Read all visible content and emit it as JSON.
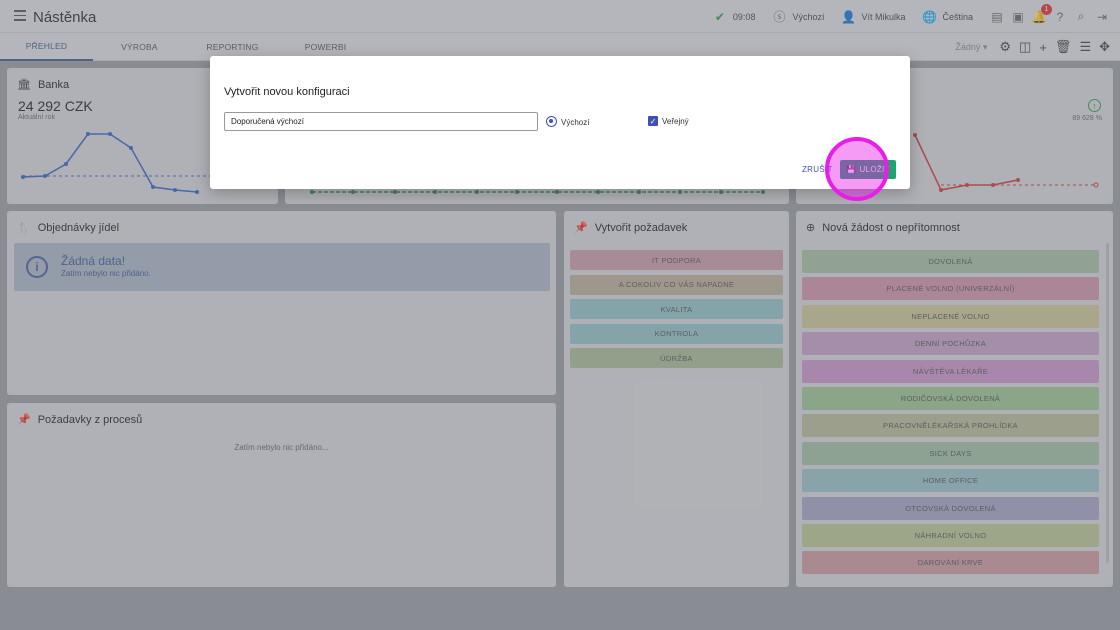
{
  "header": {
    "title": "Nástěnka",
    "time": "09:08",
    "profile": "Výchozí",
    "user": "Vít Mikulka",
    "language": "Čeština",
    "notif_count": "1"
  },
  "tabs": [
    "PŘEHLED",
    "VÝROBA",
    "REPORTING",
    "POWERBI"
  ],
  "toolbar": {
    "select_value": "Žádný"
  },
  "bank": {
    "title": "Banka",
    "amount": "24 292 CZK",
    "subtitle": "Aktuální rok",
    "right_value": "89 628 %"
  },
  "orders": {
    "title": "Objednávky jídel",
    "empty_title": "Žádná data!",
    "empty_text": "Zatím nebylo nic přidáno."
  },
  "requests": {
    "title": "Požadavky z procesů",
    "empty_text": "Zatím nebylo nic přidáno..."
  },
  "create_request": {
    "title": "Vytvořit požadavek",
    "items": [
      {
        "label": "IT PODPORA",
        "color": "#c79aa6"
      },
      {
        "label": "A COKOLIV CO VÁS NAPADNE",
        "color": "#b9ad95"
      },
      {
        "label": "KVALITA",
        "color": "#92c0c4"
      },
      {
        "label": "KONTROLA",
        "color": "#92c0c4"
      },
      {
        "label": "ÚDRŽBA",
        "color": "#a6bb96"
      }
    ]
  },
  "absence": {
    "title": "Nová žádost o nepřítomnost",
    "items": [
      {
        "label": "DOVOLENÁ",
        "color": "#a6bea0"
      },
      {
        "label": "PLACENÉ VOLNO (UNIVERZÁLNÍ)",
        "color": "#cc93a8"
      },
      {
        "label": "NEPLACENÉ VOLNO",
        "color": "#c9c495"
      },
      {
        "label": "DENNÍ POCHŮZKA",
        "color": "#c29ec5"
      },
      {
        "label": "NÁVŠTĚVA LÉKAŘE",
        "color": "#c696c8"
      },
      {
        "label": "RODIČOVSKÁ DOVOLENÁ",
        "color": "#9cc292"
      },
      {
        "label": "PRACOVNĚLÉKAŘSKÁ PROHLÍDKA",
        "color": "#b6b995"
      },
      {
        "label": "SICK DAYS",
        "color": "#9fbea0"
      },
      {
        "label": "HOME OFFICE",
        "color": "#97bfc4"
      },
      {
        "label": "OTCOVSKÁ DOVOLENÁ",
        "color": "#a4a3c4"
      },
      {
        "label": "NÁHRADNÍ VOLNO",
        "color": "#b8c392"
      },
      {
        "label": "DAROVÁNÍ KRVE",
        "color": "#c9999e"
      }
    ]
  },
  "modal": {
    "title": "Vytvořit novou konfiguraci",
    "input_value": "Doporučená výchozí",
    "radio_label": "Výchozí",
    "checkbox_label": "Veřejný",
    "cancel_label": "ZRUŠIT",
    "save_label": "ULOŽIT"
  }
}
